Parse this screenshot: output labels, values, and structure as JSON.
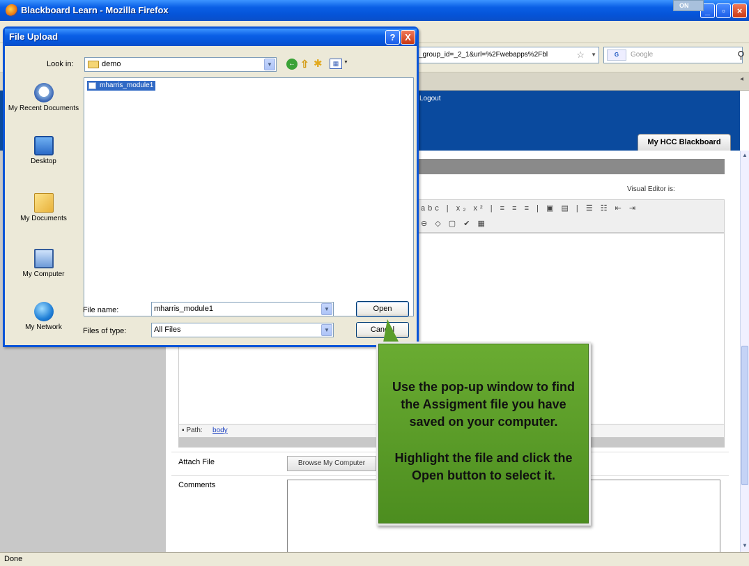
{
  "browser": {
    "window_title": "Blackboard Learn - Mozilla Firefox",
    "url_fragment": "_group_id=_2_1&url=%2Fwebapps%2Fbl",
    "search_engine": "G",
    "search_placeholder": "Google",
    "status": "Done"
  },
  "page": {
    "logout_text": "Logout",
    "tab_label": "My HCC Blackboard",
    "visual_editor_label": "Visual Editor is:",
    "visual_editor_state": "ON",
    "toolbar_row1": "abc | x₂ x² | ≡ ≡ ≡ | ▣ ▤ | ☰ ☷ ⇤ ⇥",
    "toolbar_row2": "⊖ ◇ ▢ ✔ ▦",
    "path_label": "Path:",
    "path_value": "body",
    "attach_file_label": "Attach File",
    "browse_button": "Browse My Computer",
    "comments_label": "Comments"
  },
  "dialog": {
    "title": "File Upload",
    "help": "?",
    "close": "X",
    "look_in_label": "Look in:",
    "look_in_value": "demo",
    "places": [
      {
        "label": "My Recent Documents",
        "icon": "recent-documents-icon"
      },
      {
        "label": "Desktop",
        "icon": "desktop-icon"
      },
      {
        "label": "My Documents",
        "icon": "my-documents-icon"
      },
      {
        "label": "My Computer",
        "icon": "my-computer-icon"
      },
      {
        "label": "My Network",
        "icon": "my-network-icon"
      }
    ],
    "files": [
      "mharris_module1"
    ],
    "file_name_label": "File name:",
    "file_name_value": "mharris_module1",
    "file_type_label": "Files of type:",
    "file_type_value": "All Files",
    "open_button": "Open",
    "cancel_button": "Cancel"
  },
  "callout": {
    "line1": "Use the pop-up window to find the Assigment file you have saved on your computer.",
    "line2": "Highlight the file and click the Open button to select it."
  },
  "colors": {
    "xp_blue": "#0554d8",
    "bb_header": "#0a4a9e",
    "callout_green": "#5a9d2a",
    "selection": "#316ac5"
  }
}
